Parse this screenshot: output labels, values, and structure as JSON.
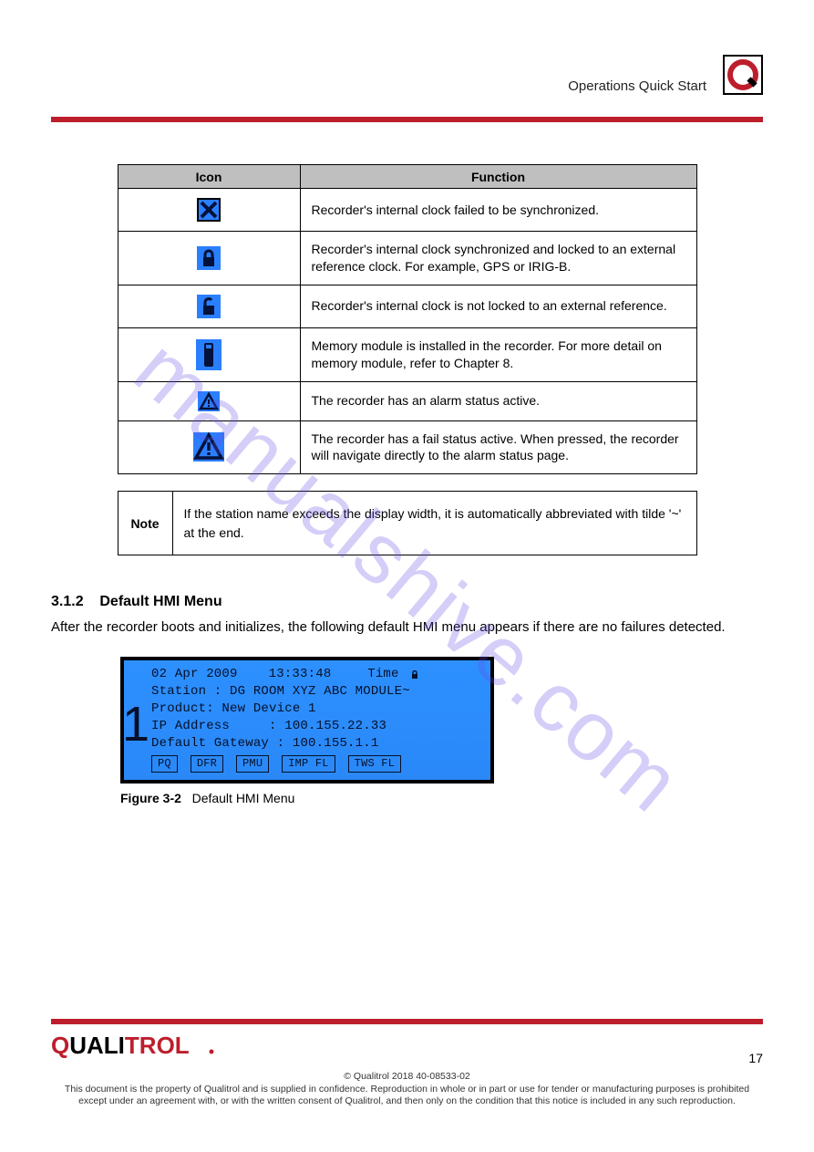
{
  "header": {
    "doc_title": "Operations Quick Start",
    "brand_small_icon": "Q"
  },
  "icon_table": {
    "columns": [
      "Icon",
      "Function"
    ],
    "rows": [
      {
        "icon": "sync-disabled-icon",
        "desc": "Recorder's internal clock failed to be synchronized."
      },
      {
        "icon": "lock-closed-icon",
        "desc": "Recorder's internal clock synchronized and locked to an\nexternal reference clock. For example, GPS or IRIG-B."
      },
      {
        "icon": "lock-open-icon",
        "desc": "Recorder's internal clock is not locked to an external reference."
      },
      {
        "icon": "memory-module-icon",
        "desc": "Memory module is installed in the recorder. For more detail on\nmemory module, refer to Chapter 8."
      },
      {
        "icon": "warning-small-icon",
        "desc": "The recorder has an alarm status active."
      },
      {
        "icon": "warning-large-icon",
        "desc": "The recorder has a fail status active. When pressed, the\nrecorder will navigate directly to the alarm status page."
      }
    ]
  },
  "note": {
    "label": "Note",
    "text": "If the station name exceeds the display width, it is automatically abbreviated with tilde '~' at the end."
  },
  "section": {
    "number": "3.1.2",
    "title": "Default HMI Menu",
    "para": "After the recorder boots and initializes, the following default HMI menu appears if there are no failures detected."
  },
  "lcd": {
    "marker": "1",
    "date": "02 Apr 2009",
    "time": "13:33:48",
    "time_label": "Time",
    "station_label": "Station :",
    "station_value": "DG ROOM XYZ ABC MODULE~",
    "product_label": "Product:",
    "product_value": "New Device 1",
    "ip_label": "IP Address",
    "ip_value": "100.155.22.33",
    "gateway_label": "Default Gateway :",
    "gateway_value": "100.155.1.1",
    "buttons": [
      "PQ",
      "DFR",
      "PMU",
      "IMP FL",
      "TWS FL"
    ],
    "caption_label": "Figure 3-2",
    "caption_text": "Default HMI Menu"
  },
  "watermark": "manualshive.com",
  "footer": {
    "brand": "QUALITROL",
    "brand_suffix": ".",
    "page": "17",
    "legal1": "© Qualitrol 2018    40-08533-02",
    "legal2": "This document is the property of Qualitrol and is supplied in confidence. Reproduction in whole or in part or use for tender or manufacturing purposes is prohibited except under an agreement with, or with the written consent of Qualitrol, and then only on the condition that this notice is included in any such reproduction."
  }
}
